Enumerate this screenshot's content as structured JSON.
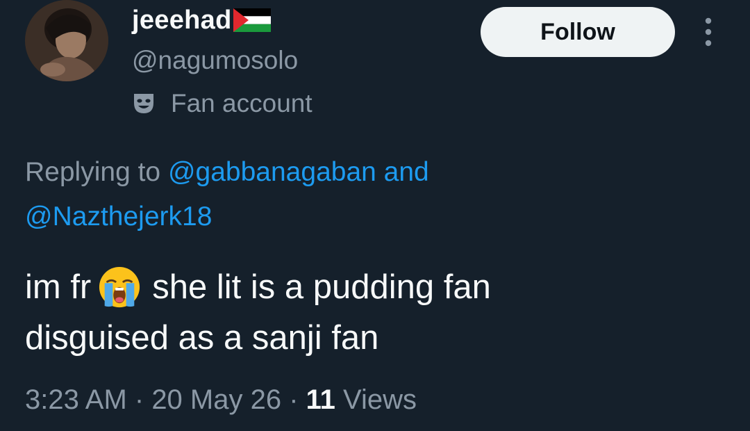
{
  "author": {
    "display_name": "jeeehad",
    "flag_icon": "palestine-flag-icon",
    "handle": "@nagumosolo",
    "label_icon": "theater-mask-icon",
    "label": "Fan account"
  },
  "actions": {
    "follow_label": "Follow",
    "more_icon": "vertical-ellipsis-icon"
  },
  "reply": {
    "prefix": "Replying to ",
    "mention_1": "@gabbanagaban",
    "joiner": " and",
    "mention_2": "@Nazthejerk18"
  },
  "tweet": {
    "line1_before_emoji": "im fr",
    "emoji": "loudly-crying-face-icon",
    "line1_after_emoji": "she lit is a pudding fan",
    "line2": "disguised as a sanji fan"
  },
  "meta": {
    "time": "3:23 AM",
    "separator": " · ",
    "date": "20 May 26",
    "views_count": "11",
    "views_label": " Views"
  },
  "colors": {
    "background": "#15202b",
    "text_primary": "#f7f9f9",
    "text_secondary": "#8b98a5",
    "link": "#1d9bf0",
    "follow_button_bg": "#eff3f4"
  }
}
